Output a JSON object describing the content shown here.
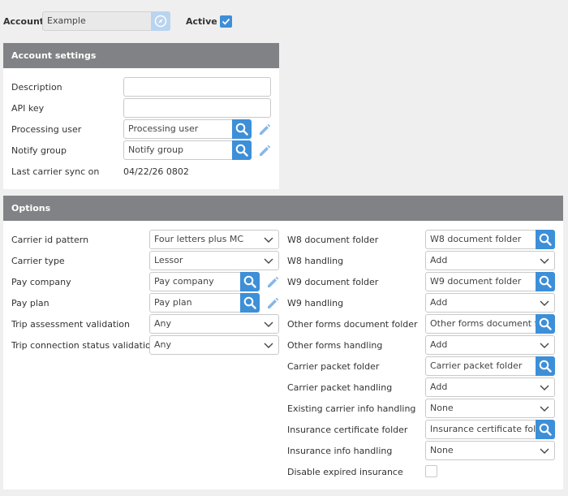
{
  "header": {
    "account_label": "Account",
    "account_value": "Example",
    "active_label": "Active"
  },
  "account_settings": {
    "title": "Account settings",
    "description_label": "Description",
    "description_value": "",
    "api_key_label": "API key",
    "api_key_value": "",
    "processing_user_label": "Processing user",
    "processing_user_value": "Processing user",
    "notify_group_label": "Notify group",
    "notify_group_value": "Notify group",
    "last_sync_label": "Last carrier sync on",
    "last_sync_value": "04/22/26 0802"
  },
  "options": {
    "title": "Options",
    "left": {
      "carrier_id_pattern_label": "Carrier id pattern",
      "carrier_id_pattern_value": "Four letters plus MC",
      "carrier_type_label": "Carrier type",
      "carrier_type_value": "Lessor",
      "pay_company_label": "Pay company",
      "pay_company_value": "Pay company",
      "pay_plan_label": "Pay plan",
      "pay_plan_value": "Pay plan",
      "trip_assessment_label": "Trip assessment validation",
      "trip_assessment_value": "Any",
      "trip_connection_label": "Trip connection status validation",
      "trip_connection_value": "Any"
    },
    "right": {
      "w8_folder_label": "W8 document folder",
      "w8_folder_value": "W8 document folder",
      "w8_handling_label": "W8 handling",
      "w8_handling_value": "Add",
      "w9_folder_label": "W9 document folder",
      "w9_folder_value": "W9 document folder",
      "w9_handling_label": "W9 handling",
      "w9_handling_value": "Add",
      "other_folder_label": "Other forms document folder",
      "other_folder_value": "Other forms document folder",
      "other_handling_label": "Other forms handling",
      "other_handling_value": "Add",
      "packet_folder_label": "Carrier packet folder",
      "packet_folder_value": "Carrier packet folder",
      "packet_handling_label": "Carrier packet handling",
      "packet_handling_value": "Add",
      "existing_info_label": "Existing carrier info handling",
      "existing_info_value": "None",
      "insurance_folder_label": "Insurance certificate folder",
      "insurance_folder_value": "Insurance certificate folder",
      "insurance_info_label": "Insurance info handling",
      "insurance_info_value": "None",
      "disable_expired_label": "Disable expired insurance"
    }
  }
}
